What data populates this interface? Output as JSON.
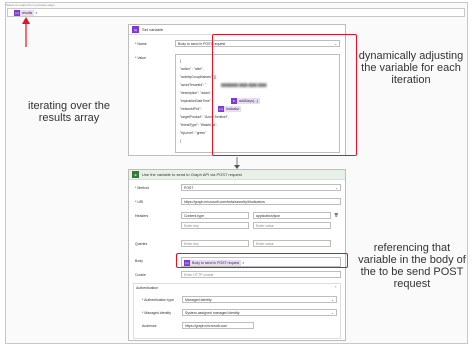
{
  "top": {
    "header_text": "Select an output from previous steps",
    "results_token": "results",
    "token_icon": "{x}"
  },
  "set_variable": {
    "title": "Set variable",
    "icon": "{x}",
    "name_label": "* Name",
    "name_value": "Body to send in POST request",
    "value_label": "* Value",
    "json_lines": [
      "{",
      "  \"action\" : \"alert\",",
      "  \"activityGroupNames\": [],",
      "  \"azureTenantId\": \"",
      "  \"description\": \"adam\",",
      "  \"expirationDateTime\":",
      "  \"networkIPv4\":",
      "  \"targetProduct\": \"Azure Sentinel\",",
      "  \"threatType\": \"WatchList\",",
      "  \"tlpLevel\": \"green\"",
      "}"
    ],
    "adddays_token": "addDays(...)",
    "indicator_token": "Indicator"
  },
  "http": {
    "title": "Use the variable to send to Graph API via POST request",
    "method_label": "* Method",
    "method_value": "POST",
    "uri_label": "* URI",
    "uri_value": "https://graph.microsoft.com/beta/security/tiIndicators",
    "headers_label": "Headers",
    "header_key": "Content-type",
    "header_value": "application/json",
    "enter_key": "Enter key",
    "enter_value": "Enter value",
    "queries_label": "Queries",
    "body_label": "Body",
    "body_token": "Body to send in POST request",
    "cookie_label": "Cookie",
    "cookie_placeholder": "Enter HTTP cookie",
    "auth_label": "Authentication",
    "auth_type_label": "* Authentication type",
    "auth_type_value": "Managed identity",
    "managed_identity_label": "* Managed identity",
    "managed_identity_value": "System-assigned managed identity",
    "audience_label": "Audience",
    "audience_value": "https://graph.microsoft.com"
  },
  "annotations": {
    "iterating": "iterating over the results array",
    "dynamic": "dynamically adjusting the variable for each iteration",
    "referencing": "referencing that variable in the body of the to be send POST request"
  },
  "colors": {
    "accent_red": "#e81123",
    "variable_purple": "#7e3bd0",
    "http_green": "#357a38"
  }
}
